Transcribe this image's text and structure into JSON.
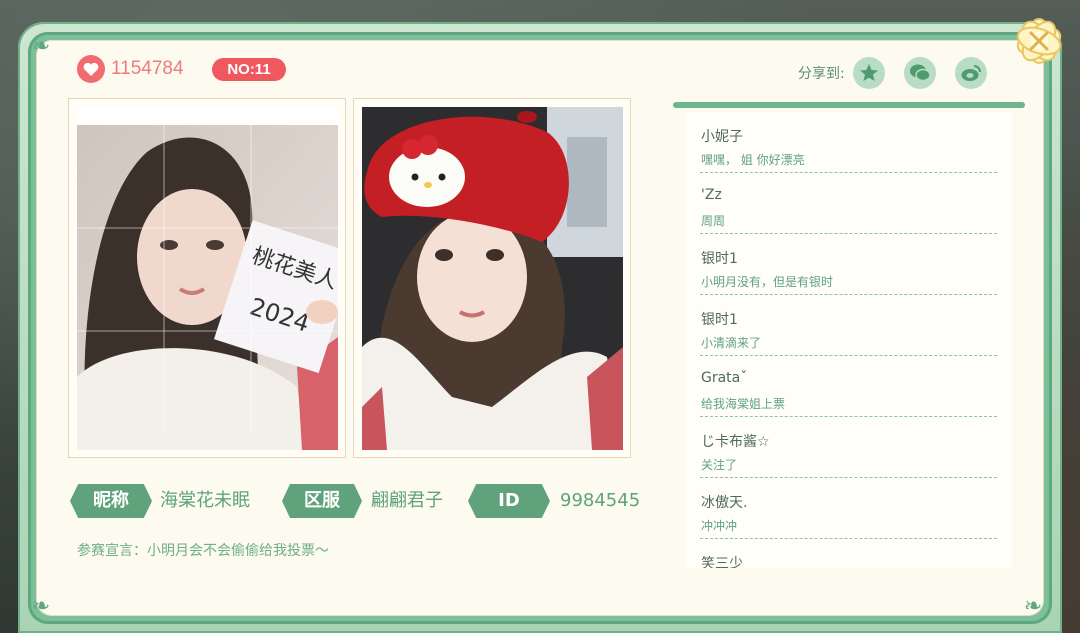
{
  "header": {
    "likes_count": "1154784",
    "rank": "NO:11",
    "share_label": "分享到:",
    "share_targets": [
      "qq-zone",
      "wechat",
      "weibo"
    ]
  },
  "photos": [
    {
      "description_icon": "contestant-photo-holding-sign",
      "sign_text": "桃花美人 2024"
    },
    {
      "description_icon": "contestant-photo-red-beret"
    }
  ],
  "profile": {
    "nickname_label": "昵称",
    "nickname_value": "海棠花未眠",
    "server_label": "区服",
    "server_value": "翩翩君子",
    "id_label": "ID",
    "id_value": "9984545",
    "declaration": "参赛宣言：小明月会不会偷偷给我投票～"
  },
  "comments": [
    {
      "user": "小妮子",
      "text": "嘿嘿， 姐 你好漂亮"
    },
    {
      "user": "'Zz",
      "text": "周周"
    },
    {
      "user": "银时1",
      "text": "小明月没有，但是有银时"
    },
    {
      "user": "银时1",
      "text": "小清滴来了"
    },
    {
      "user": "Grataˇ",
      "text": "给我海棠姐上票"
    },
    {
      "user": "じ卡布酱☆",
      "text": "关注了"
    },
    {
      "user": "冰傲天.",
      "text": "冲冲冲"
    },
    {
      "user": "笑三少",
      "text": ""
    }
  ],
  "colors": {
    "accent_green": "#5fa27c",
    "like_red": "#f05860",
    "card_bg": "#fdfaf0"
  }
}
